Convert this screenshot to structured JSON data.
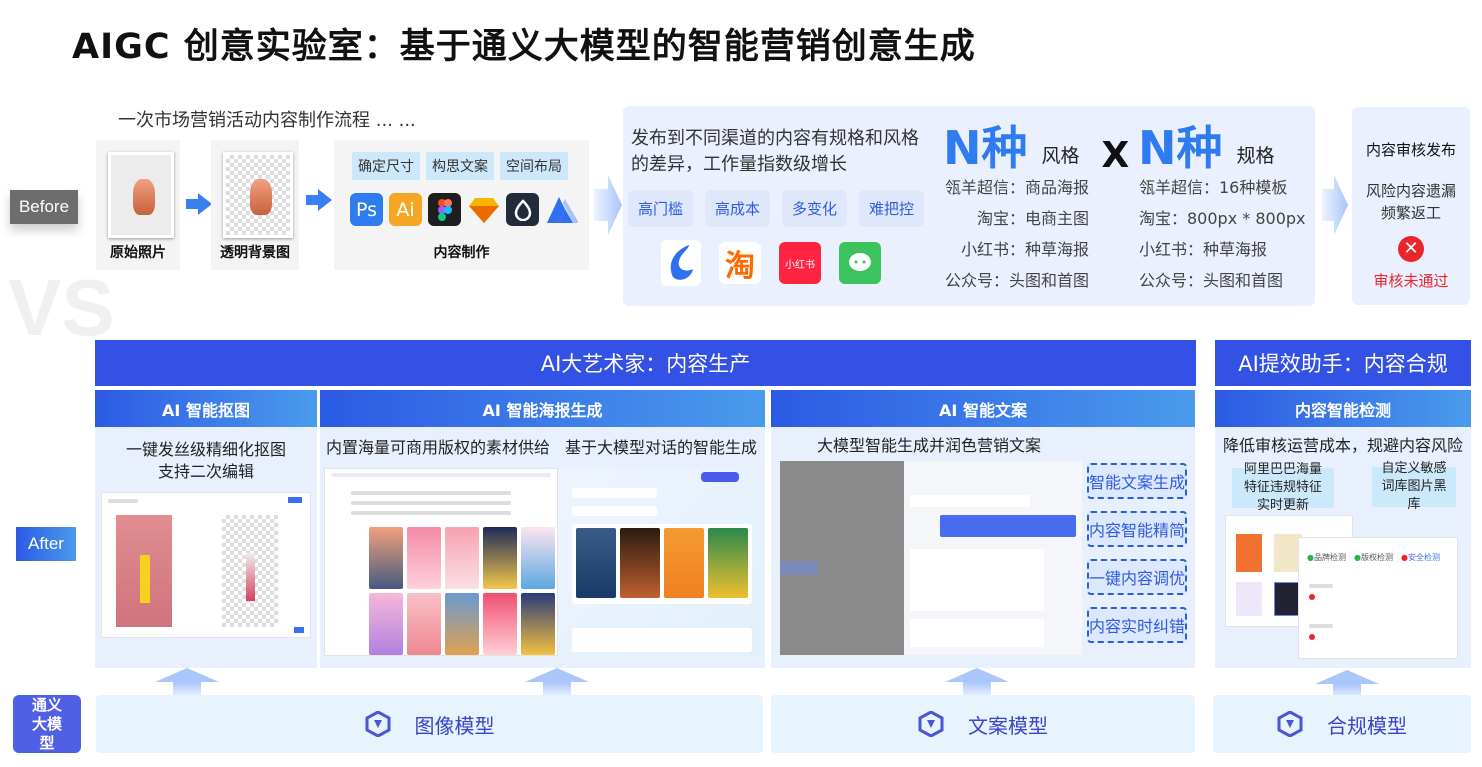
{
  "title": "AIGC 创意实验室：基于通义大模型的智能营销创意生成",
  "watermark": "VS",
  "before": {
    "label": "Before",
    "flow_title": "一次市场营销活动内容制作流程 ... ...",
    "steps": [
      "原始照片",
      "透明背景图",
      "内容制作"
    ],
    "tasks": [
      "确定尺寸",
      "构思文案",
      "空间布局"
    ],
    "tools": [
      {
        "name": "photoshop-icon",
        "text": "Ps",
        "color": "#2e7cf0"
      },
      {
        "name": "illustrator-icon",
        "text": "Ai",
        "color": "#f5a623"
      },
      {
        "name": "figma-icon",
        "text": "",
        "color": "#1e1e1e"
      },
      {
        "name": "sketch-icon",
        "text": "",
        "color": "#f7b500"
      },
      {
        "name": "lanhu-icon",
        "text": "",
        "color": "#232b3a"
      },
      {
        "name": "mastergo-icon",
        "text": "",
        "color": "#2f6ff0"
      }
    ],
    "channel_desc": "发布到不同渠道的内容有规格和风格的差异，工作量指数级增长",
    "pains": [
      "高门槛",
      "高成本",
      "多变化",
      "难把控"
    ],
    "channels": [
      {
        "name": "lingyang-icon",
        "color": "#2f6ff0"
      },
      {
        "name": "taobao-icon",
        "text": "淘",
        "color": "#ff6a00"
      },
      {
        "name": "xiaohongshu-icon",
        "text": "小红书",
        "color": "#ff2442"
      },
      {
        "name": "wechat-icon",
        "color": "#3cc35e"
      }
    ],
    "n_styles": "N种",
    "styles_label": "风格",
    "times": "X",
    "n_specs": "N种",
    "specs_label": "规格",
    "styles": [
      "瓴羊超信：商品海报",
      "淘宝：电商主图",
      "小红书：种草海报",
      "公众号：头图和首图"
    ],
    "specs": [
      "瓴羊超信：16种模板",
      "淘宝：800px * 800px",
      "小红书：种草海报",
      "公众号：头图和首图"
    ],
    "review": {
      "title": "内容审核发布",
      "desc": "风险内容遗漏频繁返工",
      "status": "审核未通过",
      "status_color": "#e8262c"
    }
  },
  "after": {
    "label": "After",
    "production": "AI大艺术家：内容生产",
    "compliance": "AI提效助手：内容合规",
    "modules": [
      {
        "title": "AI 智能抠图",
        "desc": [
          "一键发丝级精细化抠图",
          "支持二次编辑"
        ]
      },
      {
        "title": "AI 智能海报生成",
        "desc": [
          "内置海量可商用版权的素材供给",
          "基于大模型对话的智能生成"
        ]
      },
      {
        "title": "AI 智能文案",
        "desc": [
          "大模型智能生成并润色营销文案"
        ],
        "features": [
          "智能文案生成",
          "内容智能精简",
          "一键内容调优",
          "内容实时纠错"
        ]
      },
      {
        "title": "内容智能检测",
        "desc": [
          "降低审核运营成本，规避内容风险"
        ],
        "features": [
          "阿里巴巴海量特征违规特征实时更新",
          "自定义敏感词库图片黑库"
        ],
        "checks": [
          "品牌检测",
          "版权检测",
          "安全检测"
        ]
      }
    ]
  },
  "base": {
    "label": "通义大模型",
    "models": [
      "图像模型",
      "文案模型",
      "合规模型"
    ]
  },
  "colors": {
    "primary": "#3451e6",
    "accent": "#2f7cf0",
    "panel": "#e8f0fd"
  }
}
